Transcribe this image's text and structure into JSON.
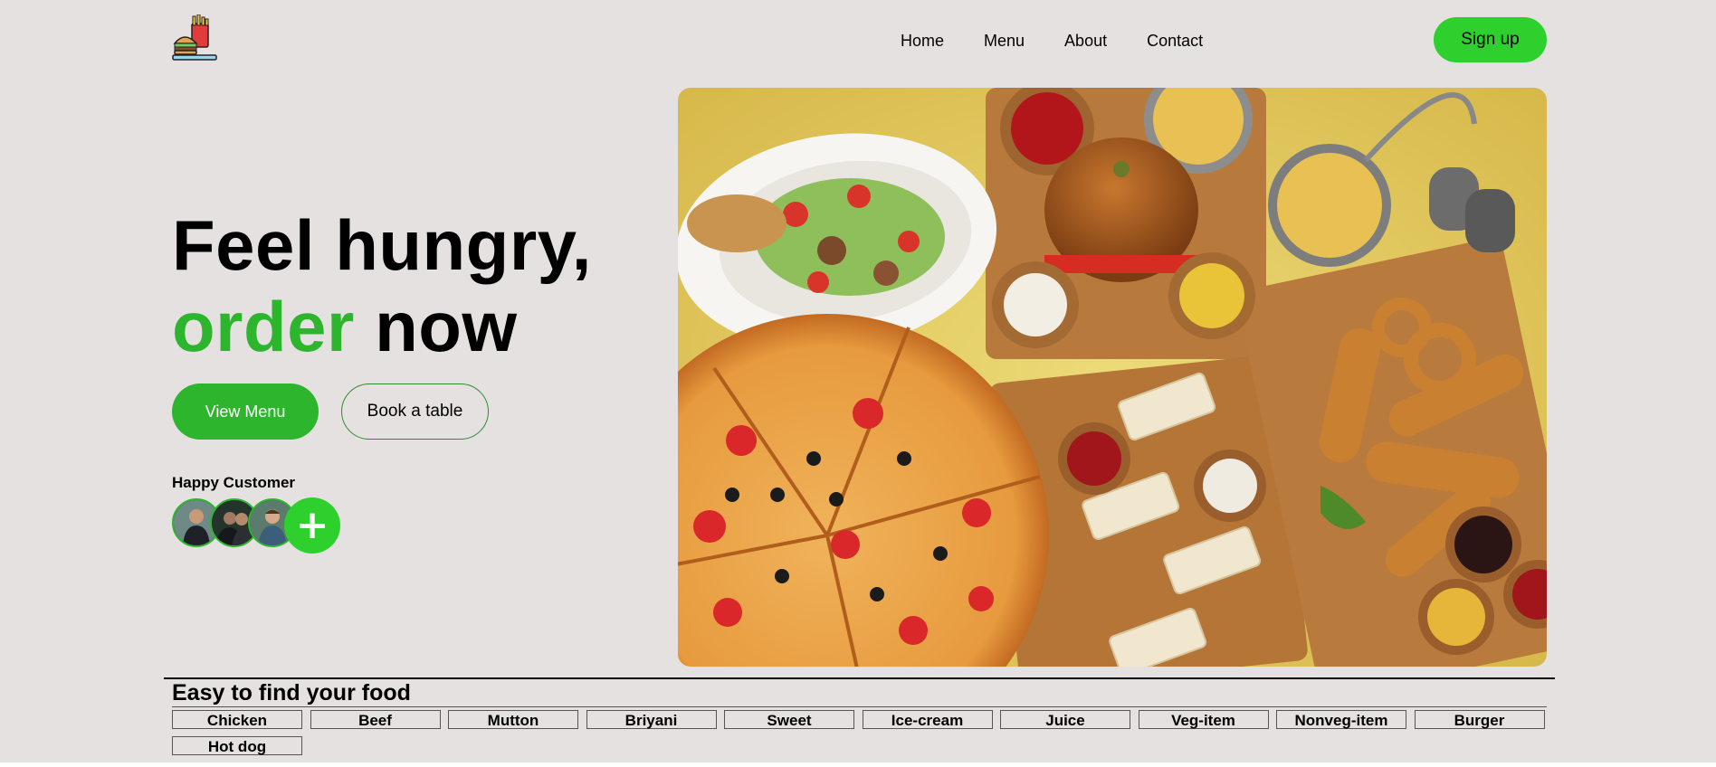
{
  "header": {
    "logo_icon": "burger-fries-logo-icon",
    "nav": [
      "Home",
      "Menu",
      "About",
      "Contact"
    ],
    "signup_label": "Sign up"
  },
  "hero": {
    "headline_line1": "Feel hungry,",
    "headline_green": "order",
    "headline_rest": "now",
    "view_menu_label": "View Menu",
    "book_table_label": "Book a table",
    "happy_customer_label": "Happy Customer",
    "plus_symbol": "+",
    "image": "food-spread-photo"
  },
  "categories": {
    "title": "Easy to find your food",
    "items": [
      "Chicken",
      "Beef",
      "Mutton",
      "Briyani",
      "Sweet",
      "Ice-cream",
      "Juice",
      "Veg-item",
      "Nonveg-item",
      "Burger",
      "Hot dog"
    ]
  },
  "colors": {
    "background": "#e6e1e1",
    "accent_green": "#2eb52e",
    "signup_green": "#2dd02d"
  }
}
